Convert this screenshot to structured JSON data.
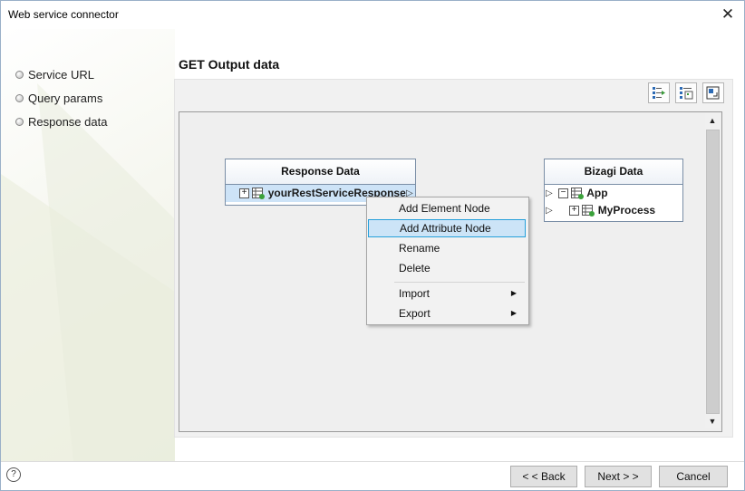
{
  "window": {
    "title": "Web service connector",
    "close_label": "✕"
  },
  "sidebar": {
    "items": [
      {
        "label": "Service URL"
      },
      {
        "label": "Query params"
      },
      {
        "label": "Response data"
      }
    ]
  },
  "main": {
    "title": "GET Output data",
    "toolbar": {
      "buttons": [
        {
          "icon": "map-nodes-icon"
        },
        {
          "icon": "list-nodes-icon"
        },
        {
          "icon": "layout-icon"
        }
      ]
    },
    "response_tree": {
      "header": "Response Data",
      "rows": [
        {
          "label": "yourRestServiceResponse",
          "expander": "+"
        }
      ]
    },
    "bizagi_tree": {
      "header": "Bizagi Data",
      "rows": [
        {
          "label": "App",
          "expander": "−"
        },
        {
          "label": "MyProcess",
          "expander": "+"
        }
      ]
    },
    "context_menu": {
      "items": [
        {
          "label": "Add Element Node"
        },
        {
          "label": "Add Attribute Node",
          "highlighted": true
        },
        {
          "label": "Rename"
        },
        {
          "label": "Delete"
        },
        {
          "label": "Import",
          "submenu": true
        },
        {
          "label": "Export",
          "submenu": true
        }
      ]
    }
  },
  "footer": {
    "help_label": "?",
    "back_label": "< < Back",
    "next_label": "Next > >",
    "cancel_label": "Cancel"
  },
  "colors": {
    "accent_highlight": "#cce4f7",
    "accent_border": "#26a0da",
    "tree_border": "#7a8ea6"
  }
}
